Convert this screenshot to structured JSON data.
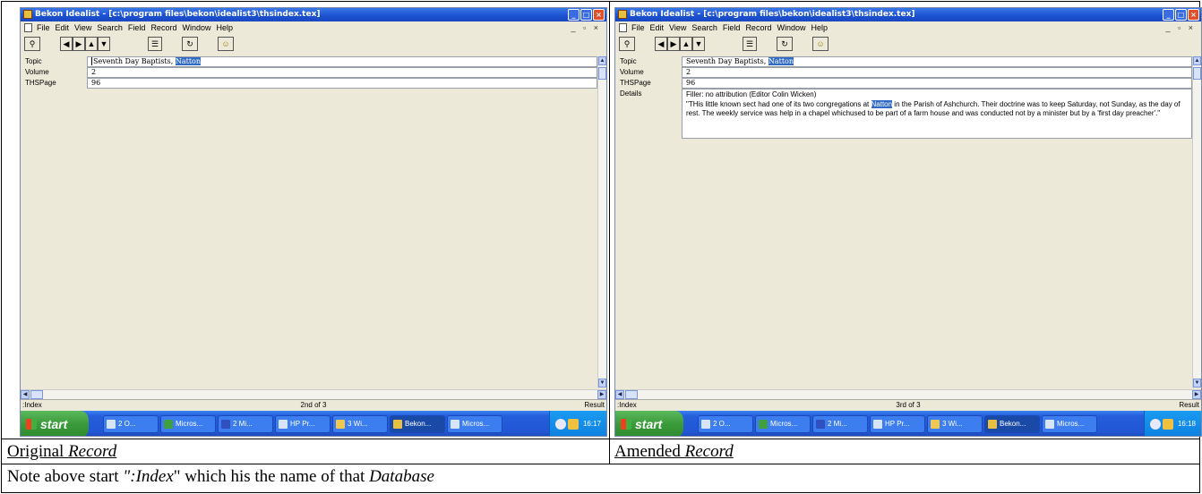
{
  "screens": [
    {
      "title": "Bekon Idealist - [c:\\program files\\bekon\\idealist3\\thsindex.tex]",
      "menu": [
        "File",
        "Edit",
        "View",
        "Search",
        "Field",
        "Record",
        "Window",
        "Help"
      ],
      "mdi_controls": "_ ▫ ×",
      "fields": [
        {
          "label": "Topic",
          "value": "Seventh Day Baptists, ",
          "highlight": "Natton"
        },
        {
          "label": "Volume",
          "value": "2"
        },
        {
          "label": "THSPage",
          "value": "96"
        }
      ],
      "status_left": ":Index",
      "status_center": "2nd of 3",
      "status_right": "Result",
      "clock": "16:17"
    },
    {
      "title": "Bekon Idealist - [c:\\program files\\bekon\\idealist3\\thsindex.tex]",
      "menu": [
        "File",
        "Edit",
        "View",
        "Search",
        "Field",
        "Record",
        "Window",
        "Help"
      ],
      "mdi_controls": "_ ▫ ×",
      "fields": [
        {
          "label": "Topic",
          "value": "Seventh Day Baptists, ",
          "highlight": "Natton"
        },
        {
          "label": "Volume",
          "value": "2"
        },
        {
          "label": "THSPage",
          "value": "96"
        }
      ],
      "details_label": "Details",
      "details": {
        "line1": "Filler: no attribution (Editor Colin Wicken)",
        "part1": "\"THis little known sect had one of its two congregations at ",
        "highlight": "Natton",
        "part2": " in the Parish of Ashchurch.  Their doctrine was to keep Saturday, not Sunday, as the day of rest.  The weekly service was help in a chapel whichused to be part of a farm house and was conducted not by a minister but by a 'first day preacher'.\""
      },
      "status_left": ":Index",
      "status_center": "3rd of 3",
      "status_right": "Result",
      "clock": "16:18"
    }
  ],
  "taskbar": {
    "start": "start",
    "items": [
      "2 O...",
      "Micros...",
      "2 Mi...",
      "HP Pr...",
      "3 Wi...",
      "Bekon...",
      "Micros..."
    ]
  },
  "captions": {
    "left_word": "Original ",
    "left_italic": "Record",
    "right_word": "Amended ",
    "right_italic": "Record",
    "note_1": "Note above start ",
    "note_q": "\":Index",
    "note_2": "\" which his the name of that ",
    "note_db": "Database"
  }
}
